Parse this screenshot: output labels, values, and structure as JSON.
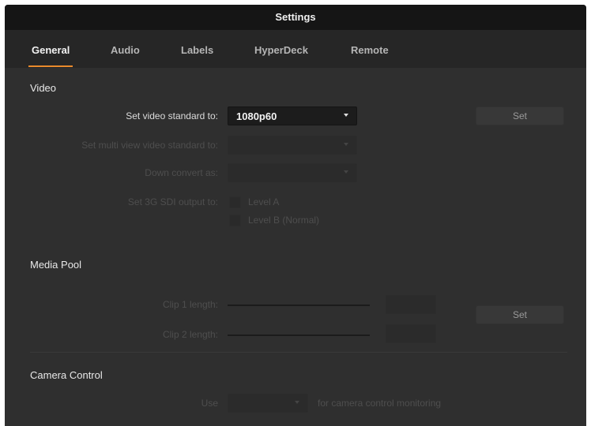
{
  "window": {
    "title": "Settings"
  },
  "tabs": [
    {
      "label": "General",
      "active": true
    },
    {
      "label": "Audio",
      "active": false
    },
    {
      "label": "Labels",
      "active": false
    },
    {
      "label": "HyperDeck",
      "active": false
    },
    {
      "label": "Remote",
      "active": false
    }
  ],
  "video": {
    "title": "Video",
    "video_standard_label": "Set video standard to:",
    "video_standard_value": "1080p60",
    "set_button": "Set",
    "multiview_label": "Set multi view video standard to:",
    "down_convert_label": "Down convert as:",
    "sdi_label": "Set 3G SDI output to:",
    "sdi_options": [
      "Level A",
      "Level B (Normal)"
    ]
  },
  "media_pool": {
    "title": "Media Pool",
    "clip1_label": "Clip 1 length:",
    "clip2_label": "Clip 2 length:",
    "set_button": "Set"
  },
  "camera_control": {
    "title": "Camera Control",
    "use_label": "Use",
    "suffix": "for camera control monitoring"
  },
  "colors": {
    "accent": "#e98a2c",
    "background": "#2f2f2f",
    "titlebar": "#151515"
  }
}
